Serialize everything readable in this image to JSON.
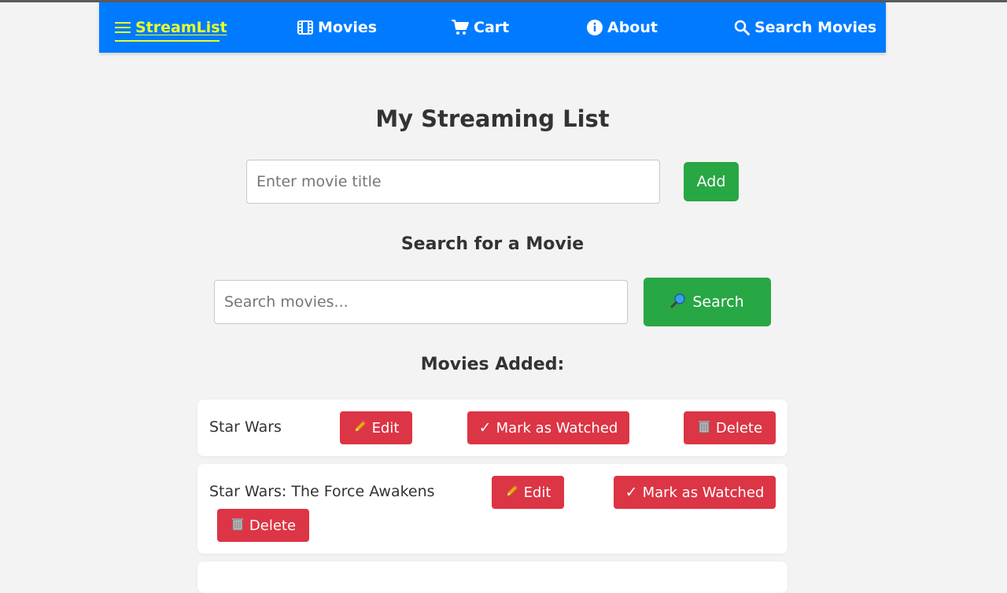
{
  "nav": {
    "brand": "StreamList",
    "movies": "Movies",
    "cart": "Cart",
    "about": "About",
    "search": "Search Movies"
  },
  "main": {
    "title": "My Streaming List",
    "add_placeholder": "Enter movie title",
    "add_label": "Add",
    "search_heading": "Search for a Movie",
    "search_placeholder": "Search movies...",
    "search_label": "Search",
    "added_heading": "Movies Added:"
  },
  "movies": [
    {
      "title": "Star Wars",
      "edit": "Edit",
      "watched": "Mark as Watched",
      "delete": "Delete"
    },
    {
      "title": "Star Wars: The Force Awakens",
      "edit": "Edit",
      "watched": "Mark as Watched",
      "delete": "Delete"
    }
  ],
  "colors": {
    "nav_bg": "#007bff",
    "brand": "#e8ff2a",
    "green": "#28a745",
    "red": "#dc3545",
    "page_bg": "#f3f3f3"
  }
}
